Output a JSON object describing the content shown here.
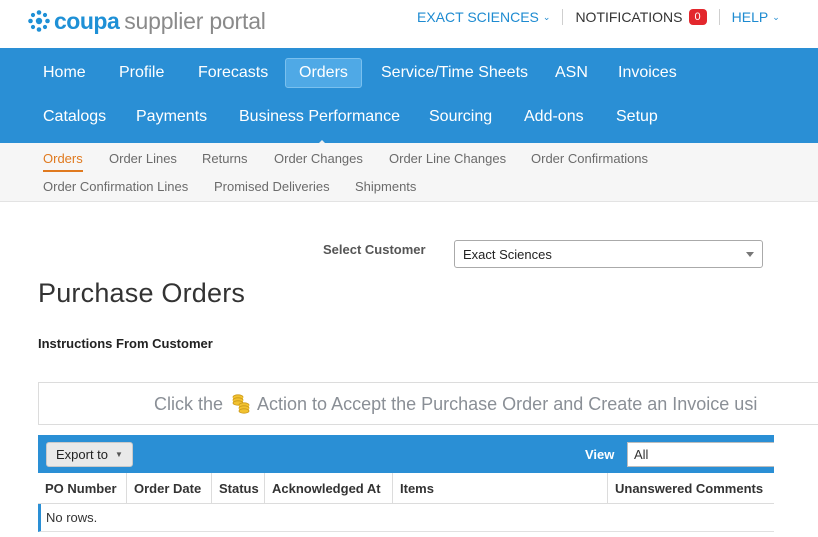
{
  "header": {
    "logo_brand": "coupa",
    "logo_product": "supplier portal",
    "customer_menu": "EXACT SCIENCES",
    "notifications_label": "NOTIFICATIONS",
    "notifications_count": "0",
    "help_label": "HELP"
  },
  "colors": {
    "brand_blue": "#2a8fd5",
    "accent_orange": "#e07a1f",
    "badge_red": "#e3272d"
  },
  "mainnav": {
    "row1": [
      "Home",
      "Profile",
      "Forecasts",
      "Orders",
      "Service/Time Sheets",
      "ASN",
      "Invoices"
    ],
    "row2": [
      "Catalogs",
      "Payments",
      "Business Performance",
      "Sourcing",
      "Add-ons",
      "Setup"
    ],
    "active": "Orders"
  },
  "subnav": {
    "row1": [
      "Orders",
      "Order Lines",
      "Returns",
      "Order Changes",
      "Order Line Changes",
      "Order Confirmations"
    ],
    "row2": [
      "Order Confirmation Lines",
      "Promised Deliveries",
      "Shipments"
    ],
    "active": "Orders"
  },
  "customer_select": {
    "label": "Select Customer",
    "value": "Exact Sciences"
  },
  "page": {
    "title": "Purchase Orders",
    "instructions_heading": "Instructions From Customer",
    "banner_before": "Click the",
    "banner_after": "Action to Accept the Purchase Order and Create an Invoice usi"
  },
  "table": {
    "export_label": "Export to",
    "view_label": "View",
    "view_value": "All",
    "columns": [
      "PO Number",
      "Order Date",
      "Status",
      "Acknowledged At",
      "Items",
      "Unanswered Comments"
    ],
    "empty_text": "No rows."
  }
}
